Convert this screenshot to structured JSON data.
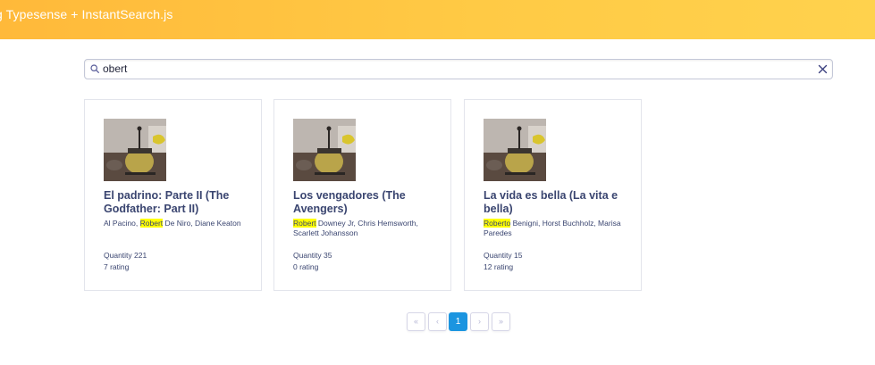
{
  "header": {
    "title": "g Typesense + InstantSearch.js"
  },
  "search": {
    "value": "obert",
    "search_icon": "search-icon",
    "reset_icon": "close-icon"
  },
  "hits": [
    {
      "title": "El padrino: Parte II (The Godfather: Part II)",
      "cast_before": "Al Pacino, ",
      "cast_highlight": "Robert",
      "cast_after": " De Niro, Diane Keaton",
      "quantity": "Quantity 221",
      "rating": "7 rating"
    },
    {
      "title": "Los vengadores (The Avengers)",
      "cast_before": "",
      "cast_highlight": "Robert",
      "cast_after": " Downey Jr, Chris Hemsworth, Scarlett Johansson",
      "quantity": "Quantity 35",
      "rating": "0 rating"
    },
    {
      "title": "La vida es bella (La vita e bella)",
      "cast_before": "",
      "cast_highlight": "Roberto",
      "cast_after": " Benigni, Horst Buchholz, Marisa Paredes",
      "quantity": "Quantity 15",
      "rating": "12 rating"
    }
  ],
  "pagination": {
    "first": "«",
    "previous": "‹",
    "current": "1",
    "next": "›",
    "last": "»"
  },
  "colors": {
    "header_start": "#ffb93a",
    "header_end": "#ffd24d",
    "title_text": "#3a4570",
    "highlight": "#ffff00",
    "active_page": "#1b95e0"
  }
}
